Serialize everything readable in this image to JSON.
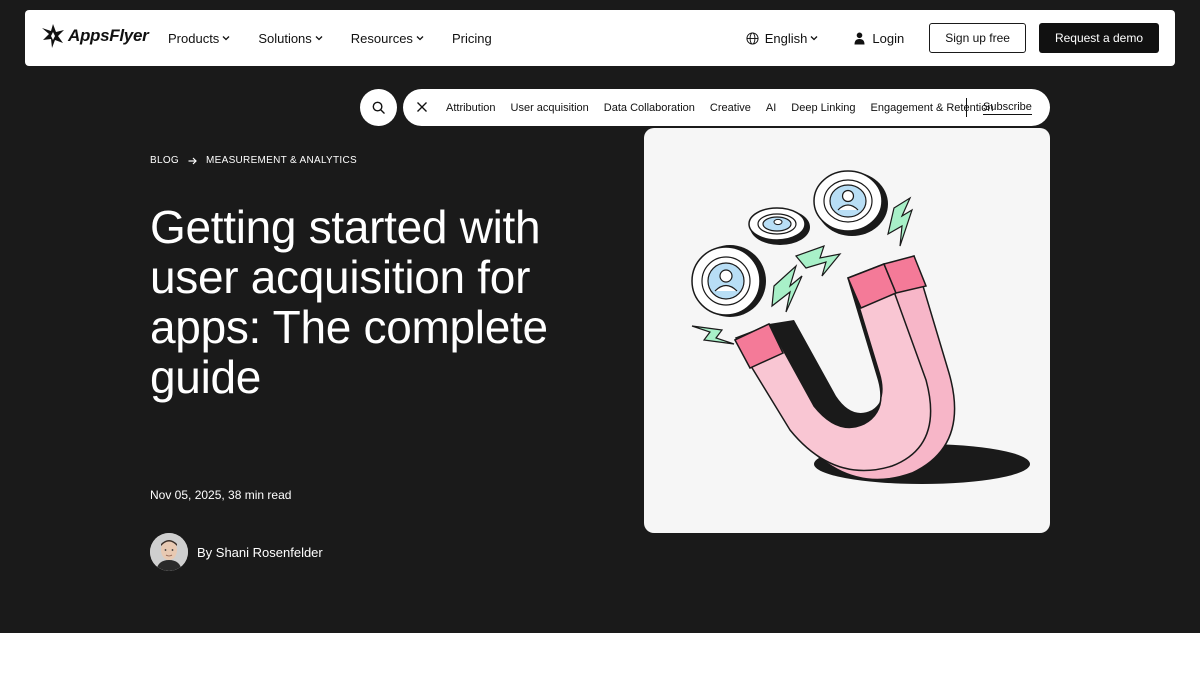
{
  "brand": {
    "name": "AppsFlyer"
  },
  "nav": {
    "items": [
      {
        "label": "Products",
        "dropdown": true
      },
      {
        "label": "Solutions",
        "dropdown": true
      },
      {
        "label": "Resources",
        "dropdown": true
      },
      {
        "label": "Pricing",
        "dropdown": false
      }
    ],
    "language": "English",
    "login": "Login",
    "signup": "Sign up free",
    "demo": "Request a demo"
  },
  "categories": {
    "items": [
      "Attribution",
      "User acquisition",
      "Data Collaboration",
      "Creative",
      "AI",
      "Deep Linking",
      "Engagement & Retention"
    ],
    "subscribe": "Subscribe"
  },
  "breadcrumb": {
    "root": "BLOG",
    "section": "MEASUREMENT & ANALYTICS"
  },
  "article": {
    "title": "Getting started with user acquisition for apps: The complete guide",
    "date_read": "Nov 05, 2025, 38 min read",
    "author": "By Shani Rosenfelder"
  },
  "colors": {
    "hero_bg": "#1a1a1a",
    "accent_pink": "#f9c6d3",
    "accent_pink_dark": "#f47a98",
    "accent_green": "#a8f0c8",
    "accent_blue": "#b8def5"
  }
}
